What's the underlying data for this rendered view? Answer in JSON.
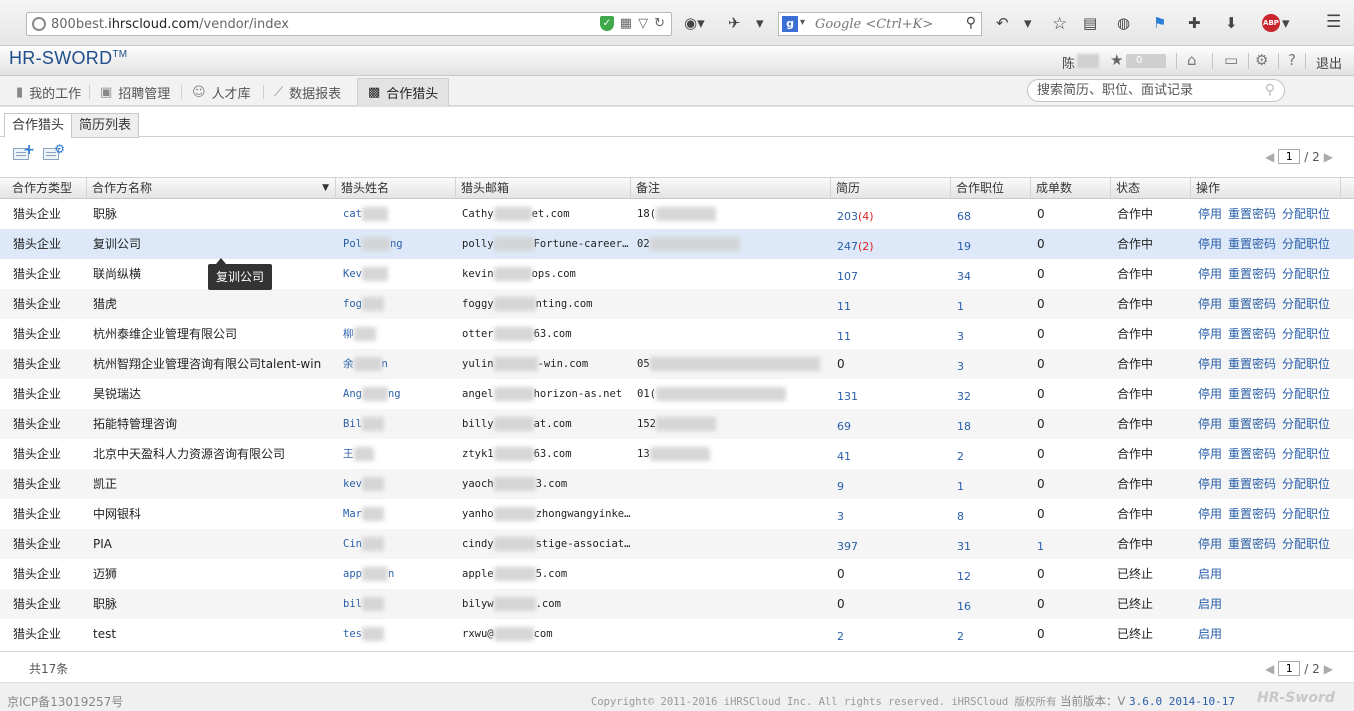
{
  "browser": {
    "url_prefix": "800best.",
    "url_domain": "ihrscloud.com",
    "url_path": "/vendor/index",
    "search_placeholder": "Google <Ctrl+K>"
  },
  "header": {
    "logo": "HR-SWORD",
    "logo_tm": "TM",
    "user_name": "陈",
    "star_count": "0",
    "logout": "退出"
  },
  "nav": {
    "items": [
      {
        "label": "我的工作",
        "icon": "trash-icon"
      },
      {
        "label": "招聘管理",
        "icon": "id-card-icon"
      },
      {
        "label": "人才库",
        "icon": "users-icon"
      },
      {
        "label": "数据报表",
        "icon": "chart-icon"
      },
      {
        "label": "合作猎头",
        "icon": "partner-icon"
      }
    ],
    "search_placeholder": "搜索简历、职位、面试记录"
  },
  "subtabs": [
    "合作猎头",
    "简历列表"
  ],
  "pager": {
    "current": "1",
    "total": "/ 2"
  },
  "columns": [
    "合作方类型",
    "合作方名称",
    "猎头姓名",
    "猎头邮箱",
    "备注",
    "简历",
    "合作职位",
    "成单数",
    "状态",
    "操作"
  ],
  "rows": [
    {
      "type": "猎头企业",
      "name": "职脉",
      "hunter": "cat",
      "email_a": "Cathy",
      "email_b": "et.com",
      "note": "18(",
      "resumes": "203",
      "resumes_new": "(4)",
      "positions": "68",
      "deals": "0",
      "status": "合作中",
      "ops": [
        "停用",
        "重置密码",
        "分配职位"
      ]
    },
    {
      "type": "猎头企业",
      "name": "复训公司",
      "hunter": "Pol",
      "hunter_tail": "ng",
      "email_a": "polly",
      "email_b": "Fortune-career…",
      "note": "02",
      "resumes": "247",
      "resumes_new": "(2)",
      "positions": "19",
      "deals": "0",
      "status": "合作中",
      "ops": [
        "停用",
        "重置密码",
        "分配职位"
      ]
    },
    {
      "type": "猎头企业",
      "name": "联尚纵横",
      "hunter": "Kev",
      "email_a": "kevin",
      "email_b": "ops.com",
      "note": "",
      "resumes": "107",
      "resumes_new": "",
      "positions": "34",
      "deals": "0",
      "status": "合作中",
      "ops": [
        "停用",
        "重置密码",
        "分配职位"
      ]
    },
    {
      "type": "猎头企业",
      "name": "猎虎",
      "hunter": "fog",
      "email_a": "foggy",
      "email_b": "nting.com",
      "note": "",
      "resumes": "11",
      "resumes_new": "",
      "positions": "1",
      "deals": "0",
      "status": "合作中",
      "ops": [
        "停用",
        "重置密码",
        "分配职位"
      ]
    },
    {
      "type": "猎头企业",
      "name": "杭州泰维企业管理有限公司",
      "hunter": "柳",
      "email_a": "otter",
      "email_b": "63.com",
      "note": "",
      "resumes": "11",
      "resumes_new": "",
      "positions": "3",
      "deals": "0",
      "status": "合作中",
      "ops": [
        "停用",
        "重置密码",
        "分配职位"
      ]
    },
    {
      "type": "猎头企业",
      "name": "杭州智翔企业管理咨询有限公司talent-win",
      "hunter": "余",
      "hunter_tail": "n",
      "email_a": "yulin",
      "email_b": "-win.com",
      "note": "05",
      "resumes": "0",
      "resumes_new": "",
      "positions": "3",
      "deals": "0",
      "status": "合作中",
      "ops": [
        "停用",
        "重置密码",
        "分配职位"
      ]
    },
    {
      "type": "猎头企业",
      "name": "昊锐瑞达",
      "hunter": "Ang",
      "hunter_tail": "ng",
      "email_a": "angel",
      "email_b": "horizon-as.net",
      "note": "01(",
      "resumes": "131",
      "resumes_new": "",
      "positions": "32",
      "deals": "0",
      "status": "合作中",
      "ops": [
        "停用",
        "重置密码",
        "分配职位"
      ]
    },
    {
      "type": "猎头企业",
      "name": "拓能特管理咨询",
      "hunter": "Bil",
      "email_a": "billy",
      "email_b": "at.com",
      "note": "152",
      "resumes": "69",
      "resumes_new": "",
      "positions": "18",
      "deals": "0",
      "status": "合作中",
      "ops": [
        "停用",
        "重置密码",
        "分配职位"
      ]
    },
    {
      "type": "猎头企业",
      "name": "北京中天盈科人力资源咨询有限公司",
      "hunter": "王",
      "email_a": "ztyk1",
      "email_b": "63.com",
      "note": "13",
      "resumes": "41",
      "resumes_new": "",
      "positions": "2",
      "deals": "0",
      "status": "合作中",
      "ops": [
        "停用",
        "重置密码",
        "分配职位"
      ]
    },
    {
      "type": "猎头企业",
      "name": "凯正",
      "hunter": "kev",
      "email_a": "yaoch",
      "email_b": "3.com",
      "note": "",
      "resumes": "9",
      "resumes_new": "",
      "positions": "1",
      "deals": "0",
      "status": "合作中",
      "ops": [
        "停用",
        "重置密码",
        "分配职位"
      ]
    },
    {
      "type": "猎头企业",
      "name": "中网银科",
      "hunter": "Mar",
      "email_a": "yanho",
      "email_b": "zhongwangyinke…",
      "note": "",
      "resumes": "3",
      "resumes_new": "",
      "positions": "8",
      "deals": "0",
      "status": "合作中",
      "ops": [
        "停用",
        "重置密码",
        "分配职位"
      ]
    },
    {
      "type": "猎头企业",
      "name": "PIA",
      "hunter": "Cin",
      "email_a": "cindy",
      "email_b": "stige-associat…",
      "note": "",
      "resumes": "397",
      "resumes_new": "",
      "positions": "31",
      "deals": "1",
      "status": "合作中",
      "ops": [
        "停用",
        "重置密码",
        "分配职位"
      ]
    },
    {
      "type": "猎头企业",
      "name": "迈狮",
      "hunter": "app",
      "hunter_tail": "n",
      "email_a": "apple",
      "email_b": "5.com",
      "note": "",
      "resumes": "0",
      "resumes_new": "",
      "positions": "12",
      "deals": "0",
      "status": "已终止",
      "ops": [
        "启用"
      ]
    },
    {
      "type": "猎头企业",
      "name": "职脉",
      "hunter": "bil",
      "email_a": "bilyw",
      "email_b": ".com",
      "note": "",
      "resumes": "0",
      "resumes_new": "",
      "positions": "16",
      "deals": "0",
      "status": "已终止",
      "ops": [
        "启用"
      ]
    },
    {
      "type": "猎头企业",
      "name": "test",
      "hunter": "tes",
      "email_a": "rxwu@",
      "email_b": "com",
      "note": "",
      "resumes": "2",
      "resumes_new": "",
      "positions": "2",
      "deals": "0",
      "status": "已终止",
      "ops": [
        "启用"
      ]
    }
  ],
  "tooltip": "复训公司",
  "total": "共17条",
  "footer": {
    "icp": "京ICP备13019257号",
    "copyright": "Copyright© 2011-2016 iHRSCloud Inc. All rights reserved. iHRSCloud 版权所有",
    "version_label": "当前版本：V",
    "version": "3.6.0 2014-10-17",
    "brand": "HR-Sword"
  }
}
